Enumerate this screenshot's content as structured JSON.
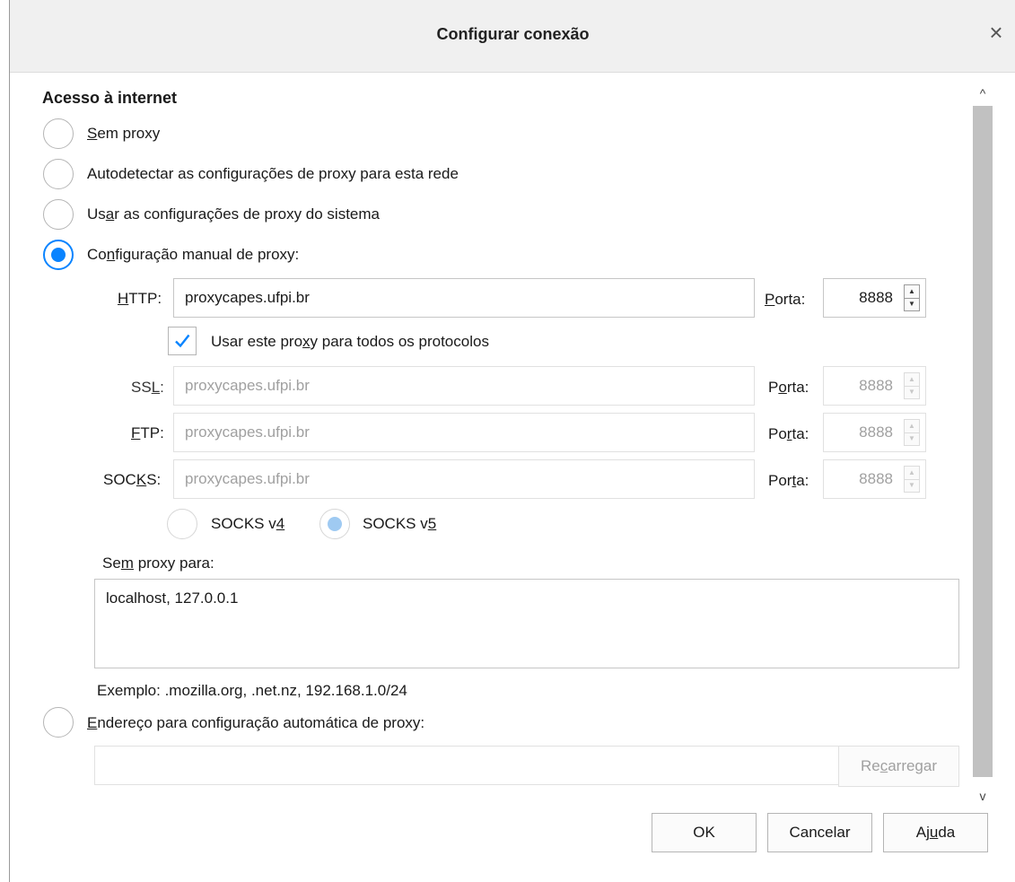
{
  "dialog": {
    "title": "Configurar conexão",
    "close_glyph": "×",
    "close_icon": "close-icon"
  },
  "section": {
    "heading": "Acesso à internet"
  },
  "options": {
    "no_proxy": {
      "label_pre": "",
      "label_acc": "S",
      "label_post": "em proxy",
      "checked": false
    },
    "auto_detect": {
      "label": "Autodetectar as configurações de proxy para esta rede",
      "checked": false
    },
    "system": {
      "label_pre": "Us",
      "label_acc": "a",
      "label_post": "r as configurações de proxy do sistema",
      "checked": false
    },
    "manual": {
      "label_pre": "Co",
      "label_acc": "n",
      "label_post": "figuração manual de proxy:",
      "checked": true
    },
    "auto_url": {
      "label_pre": "",
      "label_acc": "E",
      "label_post": "ndereço para configuração automática de proxy:",
      "checked": false
    }
  },
  "http": {
    "label_pre": "",
    "label_acc": "H",
    "label_post": "TTP:",
    "value": "proxycapes.ufpi.br",
    "port_label_pre": "",
    "port_label_acc": "P",
    "port_label_post": "orta:",
    "port": "8888"
  },
  "use_for_all": {
    "label_pre": "Usar este pro",
    "label_acc": "x",
    "label_post": "y para todos os protocolos",
    "checked": true
  },
  "ssl": {
    "label_pre": "SS",
    "label_acc": "L",
    "label_post": ":",
    "value": "proxycapes.ufpi.br",
    "port_label_pre": "P",
    "port_label_acc": "o",
    "port_label_post": "rta:",
    "port": "8888"
  },
  "ftp": {
    "label_pre": "",
    "label_acc": "F",
    "label_post": "TP:",
    "value": "proxycapes.ufpi.br",
    "port_label_pre": "Po",
    "port_label_acc": "r",
    "port_label_post": "ta:",
    "port": "8888"
  },
  "socks": {
    "label_pre": "SOC",
    "label_acc": "K",
    "label_post": "S:",
    "value": "proxycapes.ufpi.br",
    "port_label_pre": "Por",
    "port_label_acc": "t",
    "port_label_post": "a:",
    "port": "8888",
    "v4": {
      "label_pre": "SOCKS v",
      "label_acc": "4",
      "checked": false
    },
    "v5": {
      "label_pre": "SOCKS v",
      "label_acc": "5",
      "checked": true
    }
  },
  "no_proxy_for": {
    "label_pre": "Se",
    "label_acc": "m",
    "label_post": " proxy para:",
    "value": "localhost, 127.0.0.1",
    "example": "Exemplo: .mozilla.org, .net.nz, 192.168.1.0/24"
  },
  "auto_url": {
    "value": "",
    "reload_pre": "Re",
    "reload_acc": "c",
    "reload_post": "arregar"
  },
  "buttons": {
    "ok": "OK",
    "cancel": "Cancelar",
    "help_pre": "Aj",
    "help_acc": "u",
    "help_post": "da"
  },
  "icons": {
    "check": "check-icon",
    "spin_up": "▲",
    "spin_down": "▼",
    "scroll_up": "^",
    "scroll_down": "v"
  }
}
